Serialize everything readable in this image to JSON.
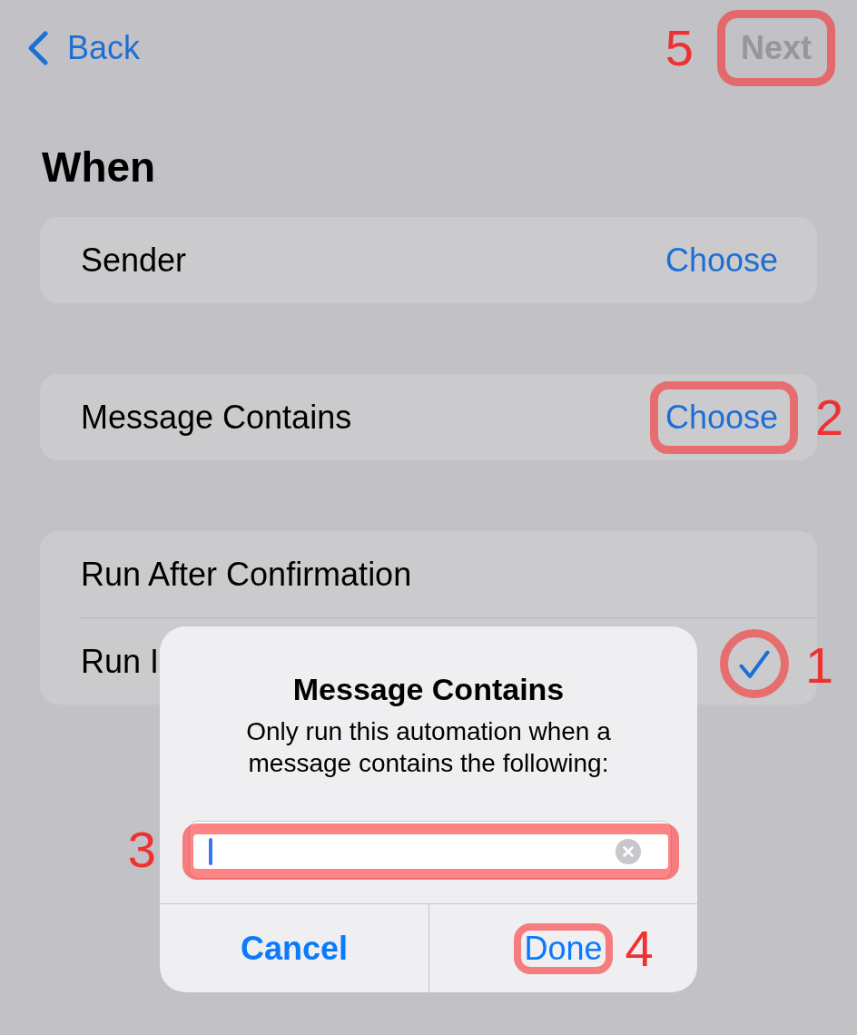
{
  "nav": {
    "back": {
      "label": "Back"
    },
    "next": {
      "label": "Next",
      "disabled": true,
      "annotation": {
        "number": "5",
        "kind": "box"
      }
    }
  },
  "section": {
    "title": "When"
  },
  "groups": [
    {
      "rows": [
        {
          "kind": "choice",
          "label": "Sender",
          "action": {
            "label": "Choose"
          }
        }
      ]
    },
    {
      "rows": [
        {
          "kind": "choice",
          "label": "Message Contains",
          "action": {
            "label": "Choose",
            "annotation": {
              "number": "2",
              "kind": "box"
            }
          }
        }
      ]
    },
    {
      "rows": [
        {
          "kind": "option",
          "label": "Run After Confirmation",
          "selected": false
        },
        {
          "kind": "option",
          "label": "Run I",
          "selected": true,
          "annotation": {
            "number": "1",
            "kind": "circle"
          }
        }
      ]
    }
  ],
  "dialog": {
    "title": "Message Contains",
    "message": "Only run this automation when a message contains the following:",
    "field": {
      "focused": true,
      "annotation": {
        "number": "3",
        "kind": "box"
      }
    },
    "buttons": [
      {
        "kind": "cancel",
        "label": "Cancel"
      },
      {
        "kind": "default",
        "label": "Done",
        "annotation": {
          "number": "4",
          "kind": "box"
        }
      }
    ]
  }
}
